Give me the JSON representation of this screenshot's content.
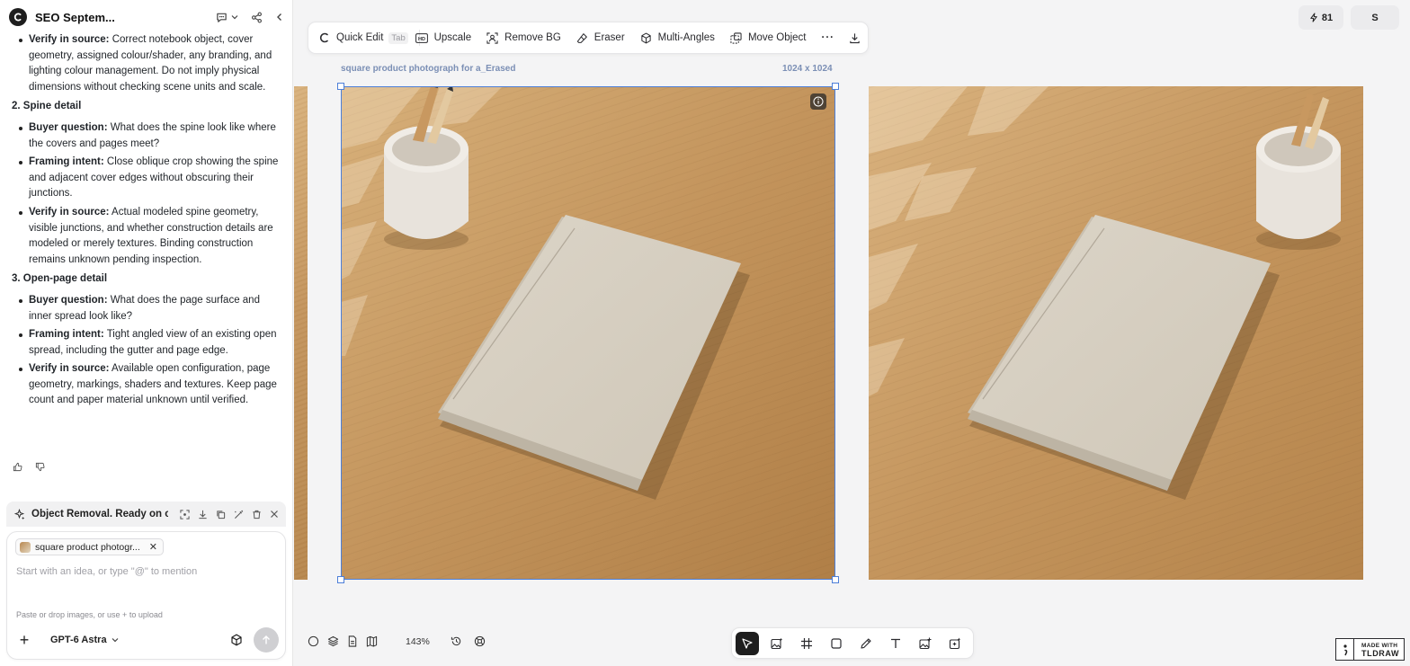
{
  "header": {
    "title": "SEO Septem...",
    "icons": [
      "logo-c",
      "comment-icon",
      "chevron-down-icon",
      "share-icon",
      "collapse-icon"
    ]
  },
  "chat": {
    "top_items": [
      {
        "label": "Verify in source:",
        "text": "Correct notebook object, cover geometry, assigned colour/shader, any branding, and lighting colour management. Do not imply physical dimensions without checking scene units and scale."
      }
    ],
    "sections": [
      {
        "heading": "2. Spine detail",
        "items": [
          {
            "label": "Buyer question:",
            "text": "What does the spine look like where the covers and pages meet?"
          },
          {
            "label": "Framing intent:",
            "text": "Close oblique crop showing the spine and adjacent cover edges without obscuring their junctions."
          },
          {
            "label": "Verify in source:",
            "text": "Actual modeled spine geometry, visible junctions, and whether construction details are modeled or merely textures. Binding construction remains unknown pending inspection."
          }
        ]
      },
      {
        "heading": "3. Open-page detail",
        "items": [
          {
            "label": "Buyer question:",
            "text": "What does the page surface and inner spread look like?"
          },
          {
            "label": "Framing intent:",
            "text": "Tight angled view of an existing open spread, including the gutter and page edge."
          },
          {
            "label": "Verify in source:",
            "text": "Available open configuration, page geometry, markings, shaders and textures. Keep page count and paper material unknown until verified."
          }
        ]
      }
    ]
  },
  "task": {
    "label": "Object Removal. Ready on c..."
  },
  "composer": {
    "chip_label": "square product photogr...",
    "placeholder": "Start with an idea, or type \"@\" to mention",
    "hint": "Paste or drop images, or use + to upload",
    "model": "GPT-6 Astra"
  },
  "toolbar": {
    "quick_edit": "Quick Edit",
    "tab_hint": "Tab",
    "upscale": "Upscale",
    "remove_bg": "Remove BG",
    "eraser": "Eraser",
    "multi_angles": "Multi-Angles",
    "move_object": "Move Object",
    "more": "···"
  },
  "top_right": {
    "credits": "81",
    "avatar": "S"
  },
  "canvas": {
    "image_caption": "square product photograph for a_Erased",
    "image_size": "1024 x 1024"
  },
  "bottom": {
    "zoom": "143%"
  },
  "watermark": {
    "line1": "MADE WITH",
    "line2": "TLDRAW"
  },
  "colors": {
    "accent": "#4d7fd8",
    "caption": "#7b8fb5",
    "wood": "#c4955d",
    "notebook": "#d8d1c4"
  }
}
